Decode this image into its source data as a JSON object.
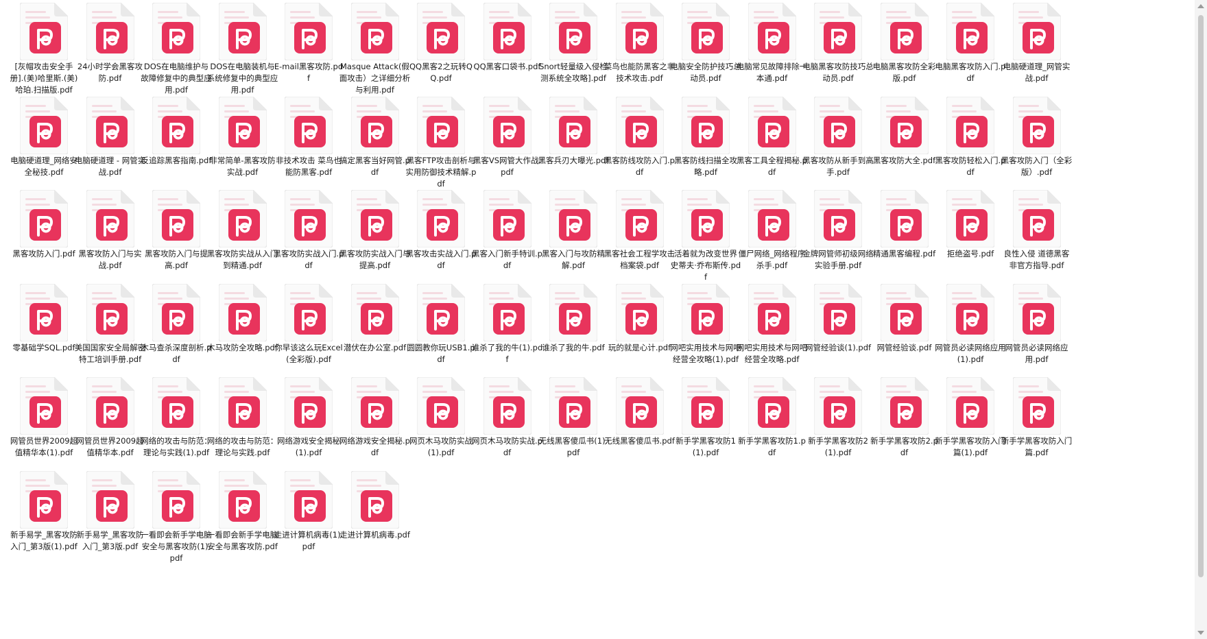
{
  "file_icon": "pdf-document-icon",
  "colors": {
    "badge": "#e8345c",
    "page": "#fafafa",
    "page_lines": "#f4dbe1",
    "fold": "#e9e9e9"
  },
  "files": [
    "[灰帽攻击安全手册].(美)哈里斯.(美)哈珀.扫描版.pdf",
    "24小时学会黑客攻防.pdf",
    "DOS在电脑维护与故障修复中的典型应用.pdf",
    "DOS在电脑装机与系统修复中的典型应用.pdf",
    "E-mail黑客攻防.pdf",
    "Masque Attack(假面攻击）之详细分析与利用.pdf",
    "QQ黑客2之玩转QQ.pdf",
    "QQ黑客口袋书.pdf",
    "Snort轻量级入侵检测系统全攻略].pdf",
    "菜鸟也能防黑客之非技术攻击.pdf",
    "电脑安全防护技巧总动员.pdf",
    "电脑常见故障排除一本通.pdf",
    "电脑黑客攻防技巧总动员.pdf",
    "电脑黑客攻防全彩版.pdf",
    "电脑黑客攻防入门.pdf",
    "电脑硬道理_网管实战.pdf",
    "电脑硬道理_网络安全秘技.pdf",
    "电脑硬道理 - 网管实战.pdf",
    "反追踪黑客指南.pdf",
    "非常简单-黑客攻防实战.pdf",
    "非技术攻击 菜鸟也能防黑客.pdf",
    "搞定黑客当好网管.pdf",
    "黑客FTP攻击剖析与实用防御技术精解.pdf",
    "黑客VS网管大作战.pdf",
    "黑客兵刃大曝光.pdf",
    "黑客防线攻防入门.pdf",
    "黑客防线扫描全攻略.pdf",
    "黑客工具全程揭秘.pdf",
    "黑客攻防从新手到高手.pdf",
    "黑客攻防大全.pdf",
    "黑客攻防轻松入门.pdf",
    "黑客攻防入门（全彩版）.pdf",
    "黑客攻防入门.pdf",
    "黑客攻防入门与实战.pdf",
    "黑客攻防入门与提高.pdf",
    "黑客攻防实战从入门到精通.pdf",
    "黑客攻防实战入门.pdf",
    "黑客攻防实战入门与提高.pdf",
    "黑客攻击实战入门.pdf",
    "黑客入门新手特训.pdf",
    "黑客入门与攻防精解.pdf",
    "黑客社会工程学攻击档案袋.pdf",
    "活着就为改变世界 史蒂夫·乔布斯传.pdf",
    "僵尸网络_网络程序杀手.pdf",
    "金牌网管师初级网络实验手册.pdf",
    "精通黑客编程.pdf",
    "拒绝盗号.pdf",
    "良性入侵 道德黑客非官方指导.pdf",
    "零基础学SQL.pdf",
    "美国国家安全局解密特工培训手册.pdf",
    "木马查杀深度剖析.pdf",
    "木马攻防全攻略.pdf",
    "你早该这么玩Excel(全彩版).pdf",
    "潜伏在办公室.pdf",
    "圆圆教你玩USB1.pdf",
    "谁杀了我的牛(1).pdf",
    "谁杀了我的牛.pdf",
    "玩的就是心计.pdf",
    "网吧实用技术与网吧经营全攻略(1).pdf",
    "网吧实用技术与网吧经营全攻略.pdf",
    "网管经验谈(1).pdf",
    "网管经验谈.pdf",
    "网管员必读网络应用(1).pdf",
    "网管员必读网络应用.pdf",
    "网管员世界2009超值精华本(1).pdf",
    "网管员世界2009超值精华本.pdf",
    "网络的攻击与防范：理论与实践(1).pdf",
    "网络的攻击与防范：理论与实践.pdf",
    "网络游戏安全揭秘(1).pdf",
    "网络游戏安全揭秘.pdf",
    "网页木马攻防实战(1).pdf",
    "网页木马攻防实战.pdf",
    "无线黑客傻瓜书(1).pdf",
    "无线黑客傻瓜书.pdf",
    "新手学黑客攻防1(1).pdf",
    "新手学黑客攻防1.pdf",
    "新手学黑客攻防2(1).pdf",
    "新手学黑客攻防2.pdf",
    "新手学黑客攻防入门篇(1).pdf",
    "新手学黑客攻防入门篇.pdf",
    "新手易学_黑客攻防入门_第3版(1).pdf",
    "新手易学_黑客攻防入门_第3版.pdf",
    "一看即会新手学电脑安全与黑客攻防(1).pdf",
    "一看即会新手学电脑安全与黑客攻防.pdf",
    "走进计算机病毒(1).pdf",
    "走进计算机病毒.pdf"
  ]
}
